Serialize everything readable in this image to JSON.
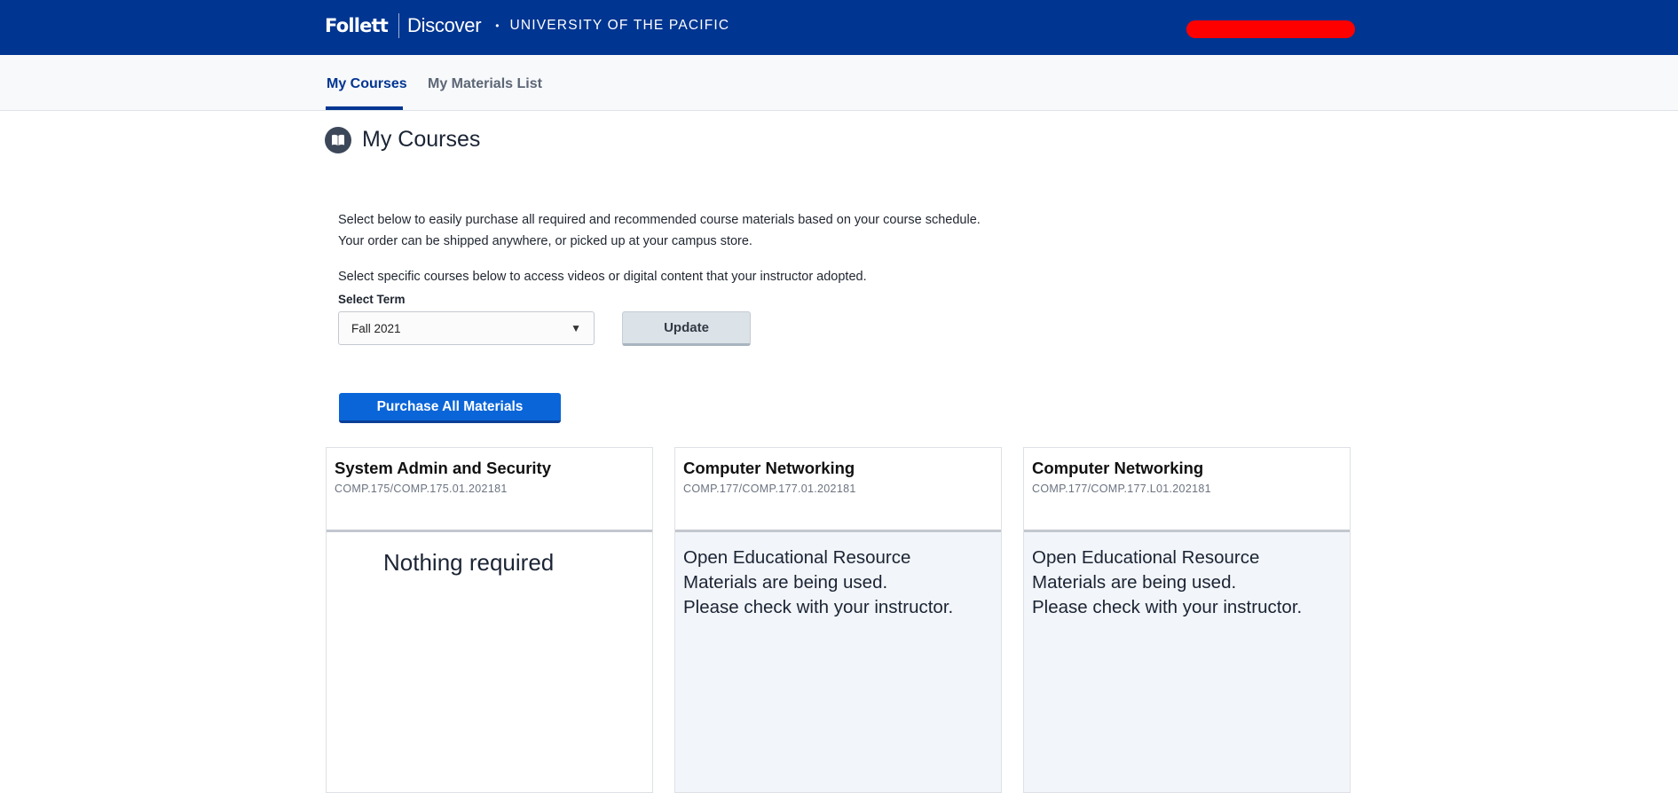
{
  "header": {
    "brand_primary": "Follett",
    "brand_secondary": "Discover",
    "separator_dot": "•",
    "school": "UNIVERSITY OF THE PACIFIC",
    "user_pill_color": "#ff0000",
    "bar_color": "#003591"
  },
  "nav": {
    "tabs": [
      {
        "label": "My Courses",
        "active": true
      },
      {
        "label": "My Materials List",
        "active": false
      }
    ]
  },
  "page": {
    "icon": "book-icon",
    "title": "My Courses",
    "intro_line1": "Select below to easily purchase all required and recommended course materials based on your course schedule.",
    "intro_line2": "Your order can be shipped anywhere, or picked up at your campus store.",
    "intro_line3": "Select specific courses below to access videos or digital content that your instructor adopted."
  },
  "term": {
    "label": "Select Term",
    "selected": "Fall 2021",
    "caret": "▼"
  },
  "buttons": {
    "update": "Update",
    "purchase_all": "Purchase All Materials",
    "purchase_color": "#0a65d8"
  },
  "courses": [
    {
      "title": "System Admin and Security",
      "code": "COMP.175/COMP.175.01.202181",
      "message": "Nothing required"
    },
    {
      "title": "Computer Networking",
      "code": "COMP.177/COMP.177.01.202181",
      "message_lines": [
        "Open Educational Resource",
        "Materials are being used.",
        "Please check with your instructor."
      ]
    },
    {
      "title": "Computer Networking",
      "code": "COMP.177/COMP.177.L01.202181",
      "message_lines": [
        "Open Educational Resource",
        "Materials are being used.",
        "Please check with your instructor."
      ]
    }
  ]
}
